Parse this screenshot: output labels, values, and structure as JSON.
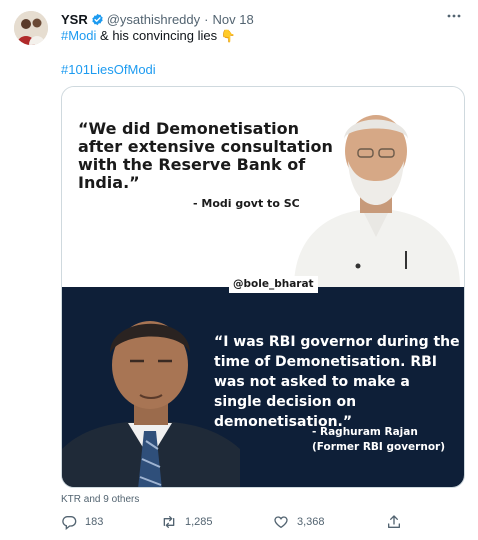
{
  "author": {
    "name": "YSR",
    "handle": "@ysathishreddy",
    "separator": "·",
    "date": "Nov 18",
    "more_icon": "more-horizontal-icon",
    "verified_color": "#1d9bf0"
  },
  "tweet": {
    "hashtag1": "#Modi",
    "text1": " & his convincing lies ",
    "emoji1": "👇",
    "hashtag2": "#101LiesOfModi"
  },
  "media": {
    "quote_top": "“We did Demonetisation after extensive consultation with the Reserve Bank of India.”",
    "attribution_top": "- Modi govt to SC",
    "watermark": "@bole_bharat",
    "quote_bottom": "“I was RBI governor during the time of Demonetisation. RBI was not asked to make a single decision on demonetisation.”",
    "attribution_bottom": "- Raghuram Rajan (Former RBI governor)",
    "bottom_bg_color": "#0e1f38"
  },
  "liked_by": "KTR and 9 others",
  "actions": {
    "replies": "183",
    "retweets": "1,285",
    "likes": "3,368"
  },
  "colors": {
    "link": "#1d9bf0",
    "secondary_text": "#536471"
  }
}
